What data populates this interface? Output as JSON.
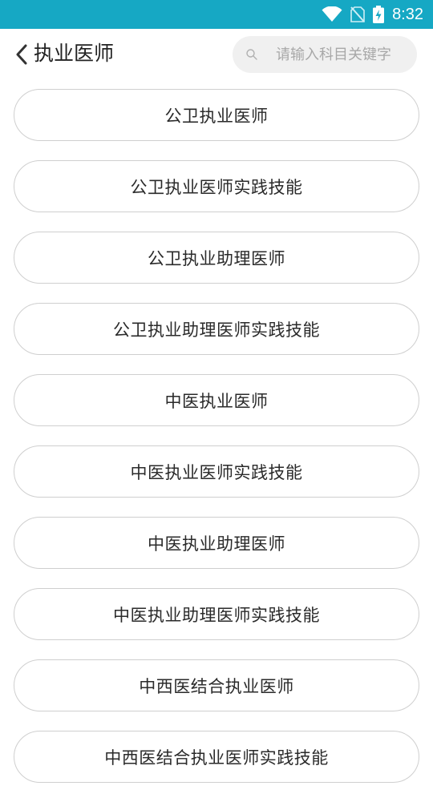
{
  "status_bar": {
    "time": "8:32",
    "icons": [
      "wifi-icon",
      "no-sim-icon",
      "battery-charging-icon"
    ]
  },
  "header": {
    "title": "执业医师",
    "back_icon": "chevron-left-icon"
  },
  "search": {
    "icon": "search-icon",
    "placeholder": "请输入科目关键字",
    "value": ""
  },
  "colors": {
    "status_bar": "#16a8c4",
    "search_bg": "#f0f0f0",
    "item_border": "#cfcfcf"
  },
  "list": {
    "items": [
      {
        "label": "公卫执业医师"
      },
      {
        "label": "公卫执业医师实践技能"
      },
      {
        "label": "公卫执业助理医师"
      },
      {
        "label": "公卫执业助理医师实践技能"
      },
      {
        "label": "中医执业医师"
      },
      {
        "label": "中医执业医师实践技能"
      },
      {
        "label": "中医执业助理医师"
      },
      {
        "label": "中医执业助理医师实践技能"
      },
      {
        "label": "中西医结合执业医师"
      },
      {
        "label": "中西医结合执业医师实践技能"
      }
    ]
  }
}
